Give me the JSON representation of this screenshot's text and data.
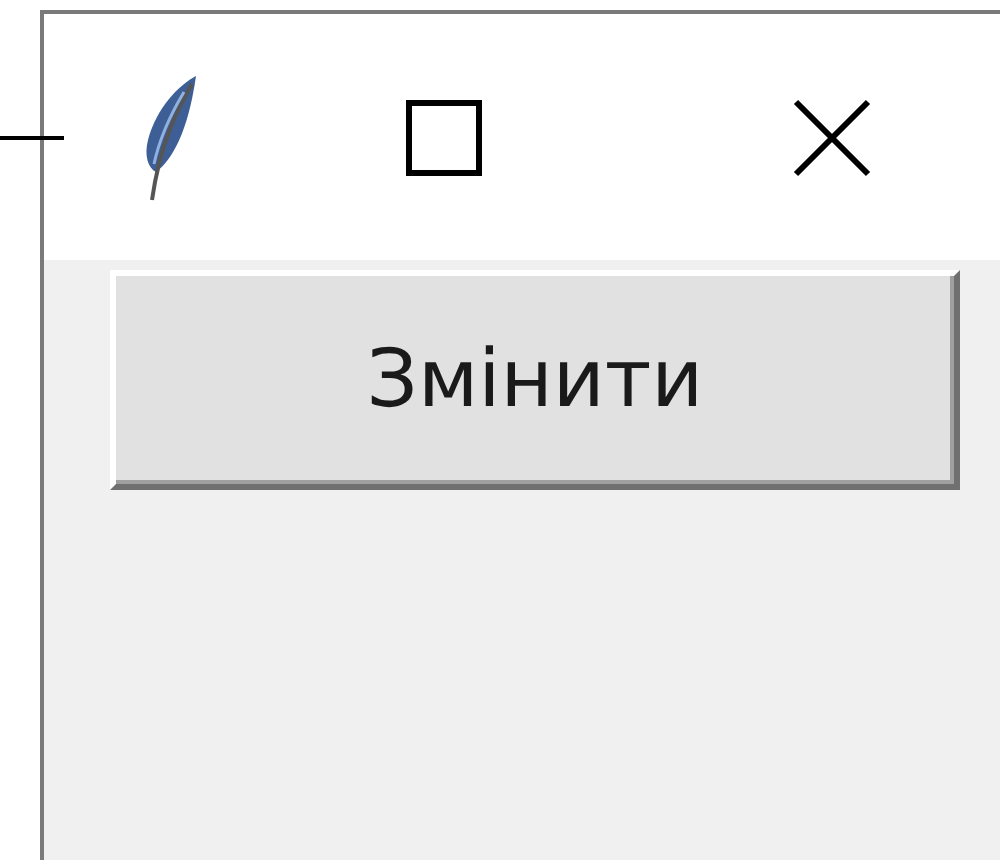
{
  "button": {
    "label": "Змінити"
  }
}
